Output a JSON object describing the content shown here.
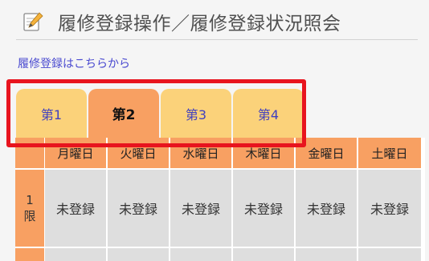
{
  "header": {
    "icon": "note-pencil-icon",
    "title": "履修登録操作／履修登録状況照会"
  },
  "link": {
    "label": "履修登録はこちらから",
    "color": "#4a4ad0"
  },
  "tabs": [
    {
      "label": "第1",
      "active": false
    },
    {
      "label": "第2",
      "active": true
    },
    {
      "label": "第3",
      "active": false
    },
    {
      "label": "第4",
      "active": false
    }
  ],
  "timetable": {
    "days": [
      "月曜日",
      "火曜日",
      "水曜日",
      "木曜日",
      "金曜日",
      "土曜日"
    ],
    "periods": [
      {
        "number": "1",
        "unit": "限",
        "slots": [
          "未登録",
          "未登録",
          "未登録",
          "未登録",
          "未登録",
          "未登録"
        ]
      }
    ]
  },
  "colors": {
    "tab_idle": "#fbd27a",
    "tab_active": "#f8a062",
    "header_cell": "#f8a062",
    "slot_cell": "#dedede",
    "highlight": "#e8141e"
  }
}
